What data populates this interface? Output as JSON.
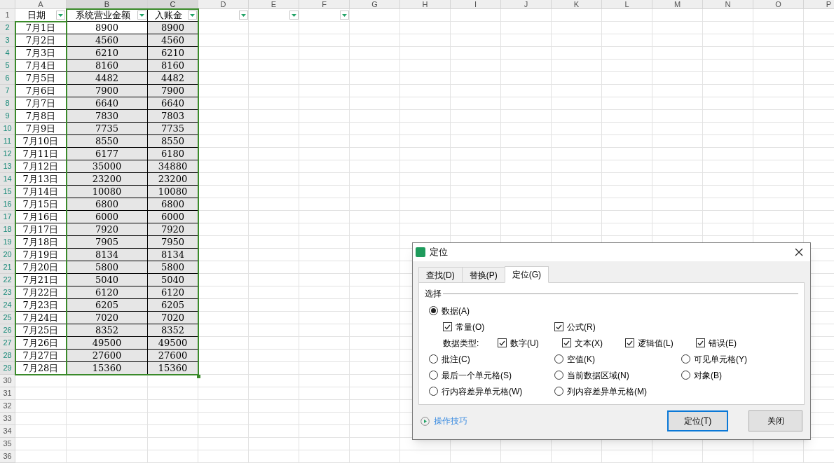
{
  "sheet": {
    "columns": [
      {
        "label": "A",
        "selected": false
      },
      {
        "label": "B",
        "selected": true
      },
      {
        "label": "C",
        "selected": true
      },
      {
        "label": "D",
        "selected": false
      },
      {
        "label": "E",
        "selected": false
      },
      {
        "label": "F",
        "selected": false
      },
      {
        "label": "G",
        "selected": false
      },
      {
        "label": "H",
        "selected": false
      },
      {
        "label": "I",
        "selected": false
      },
      {
        "label": "J",
        "selected": false
      },
      {
        "label": "K",
        "selected": false
      },
      {
        "label": "L",
        "selected": false
      },
      {
        "label": "M",
        "selected": false
      },
      {
        "label": "N",
        "selected": false
      },
      {
        "label": "O",
        "selected": false
      },
      {
        "label": "P",
        "selected": false
      }
    ],
    "header_row": [
      {
        "text": "日期",
        "filter": true
      },
      {
        "text": "系统营业金额",
        "filter": true
      },
      {
        "text": "入账金",
        "filter": true
      },
      {
        "filter": true
      },
      {
        "filter": true
      },
      {
        "filter": true
      }
    ],
    "rows": [
      {
        "date": "7月1日",
        "system": "8900",
        "booked": "8900"
      },
      {
        "date": "7月2日",
        "system": "4560",
        "booked": "4560"
      },
      {
        "date": "7月3日",
        "system": "6210",
        "booked": "6210"
      },
      {
        "date": "7月4日",
        "system": "8160",
        "booked": "8160"
      },
      {
        "date": "7月5日",
        "system": "4482",
        "booked": "4482"
      },
      {
        "date": "7月6日",
        "system": "7900",
        "booked": "7900"
      },
      {
        "date": "7月7日",
        "system": "6640",
        "booked": "6640"
      },
      {
        "date": "7月8日",
        "system": "7830",
        "booked": "7803"
      },
      {
        "date": "7月9日",
        "system": "7735",
        "booked": "7735"
      },
      {
        "date": "7月10日",
        "system": "8550",
        "booked": "8550"
      },
      {
        "date": "7月11日",
        "system": "6177",
        "booked": "6180"
      },
      {
        "date": "7月12日",
        "system": "35000",
        "booked": "34880"
      },
      {
        "date": "7月13日",
        "system": "23200",
        "booked": "23200"
      },
      {
        "date": "7月14日",
        "system": "10080",
        "booked": "10080"
      },
      {
        "date": "7月15日",
        "system": "6800",
        "booked": "6800"
      },
      {
        "date": "7月16日",
        "system": "6000",
        "booked": "6000"
      },
      {
        "date": "7月17日",
        "system": "7920",
        "booked": "7920"
      },
      {
        "date": "7月18日",
        "system": "7905",
        "booked": "7950"
      },
      {
        "date": "7月19日",
        "system": "8134",
        "booked": "8134"
      },
      {
        "date": "7月20日",
        "system": "5800",
        "booked": "5800"
      },
      {
        "date": "7月21日",
        "system": "5040",
        "booked": "5040"
      },
      {
        "date": "7月22日",
        "system": "6120",
        "booked": "6120"
      },
      {
        "date": "7月23日",
        "system": "6205",
        "booked": "6205"
      },
      {
        "date": "7月24日",
        "system": "7020",
        "booked": "7020"
      },
      {
        "date": "7月25日",
        "system": "8352",
        "booked": "8352"
      },
      {
        "date": "7月26日",
        "system": "49500",
        "booked": "49500"
      },
      {
        "date": "7月27日",
        "system": "27600",
        "booked": "27600"
      },
      {
        "date": "7月28日",
        "system": "15360",
        "booked": "15360"
      }
    ],
    "row_numbers": [
      "1",
      "2",
      "3",
      "4",
      "5",
      "6",
      "7",
      "8",
      "9",
      "10",
      "11",
      "12",
      "13",
      "14",
      "15",
      "16",
      "17",
      "18",
      "19",
      "20",
      "21",
      "22",
      "23",
      "24",
      "25",
      "26",
      "27",
      "28",
      "29",
      "30",
      "31",
      "32",
      "33",
      "34",
      "35",
      "36"
    ]
  },
  "dialog": {
    "title": "定位",
    "tabs": [
      {
        "label": "查找(D)",
        "selected": false
      },
      {
        "label": "替换(P)",
        "selected": false
      },
      {
        "label": "定位(G)",
        "selected": true
      }
    ],
    "group_label": "选择",
    "option_rows": [
      [
        {
          "kind": "radio",
          "label": "数据(A)",
          "selected": true
        }
      ],
      [
        {
          "kind": "checkbox",
          "label": "常量(O)",
          "checked": true
        },
        {
          "kind": "checkbox",
          "label": "公式(R)",
          "checked": true
        }
      ],
      [
        {
          "kind": "label",
          "label": "数据类型:"
        },
        {
          "kind": "checkbox",
          "label": "数字(U)",
          "checked": true
        },
        {
          "kind": "checkbox",
          "label": "文本(X)",
          "checked": true
        },
        {
          "kind": "checkbox",
          "label": "逻辑值(L)",
          "checked": true
        },
        {
          "kind": "checkbox",
          "label": "错误(E)",
          "checked": true
        }
      ],
      [
        {
          "kind": "radio",
          "label": "批注(C)",
          "selected": false
        },
        {
          "kind": "radio",
          "label": "空值(K)",
          "selected": false
        },
        {
          "kind": "radio",
          "label": "可见单元格(Y)",
          "selected": false
        }
      ],
      [
        {
          "kind": "radio",
          "label": "最后一个单元格(S)",
          "selected": false
        },
        {
          "kind": "radio",
          "label": "当前数据区域(N)",
          "selected": false
        },
        {
          "kind": "radio",
          "label": "对象(B)",
          "selected": false
        }
      ],
      [
        {
          "kind": "radio",
          "label": "行内容差异单元格(W)",
          "selected": false
        },
        {
          "kind": "radio",
          "label": "列内容差异单元格(M)",
          "selected": false
        }
      ]
    ],
    "tips_link": "操作技巧",
    "buttons": [
      {
        "label": "定位(T)",
        "default": true
      },
      {
        "label": "关闭",
        "default": false
      }
    ]
  }
}
